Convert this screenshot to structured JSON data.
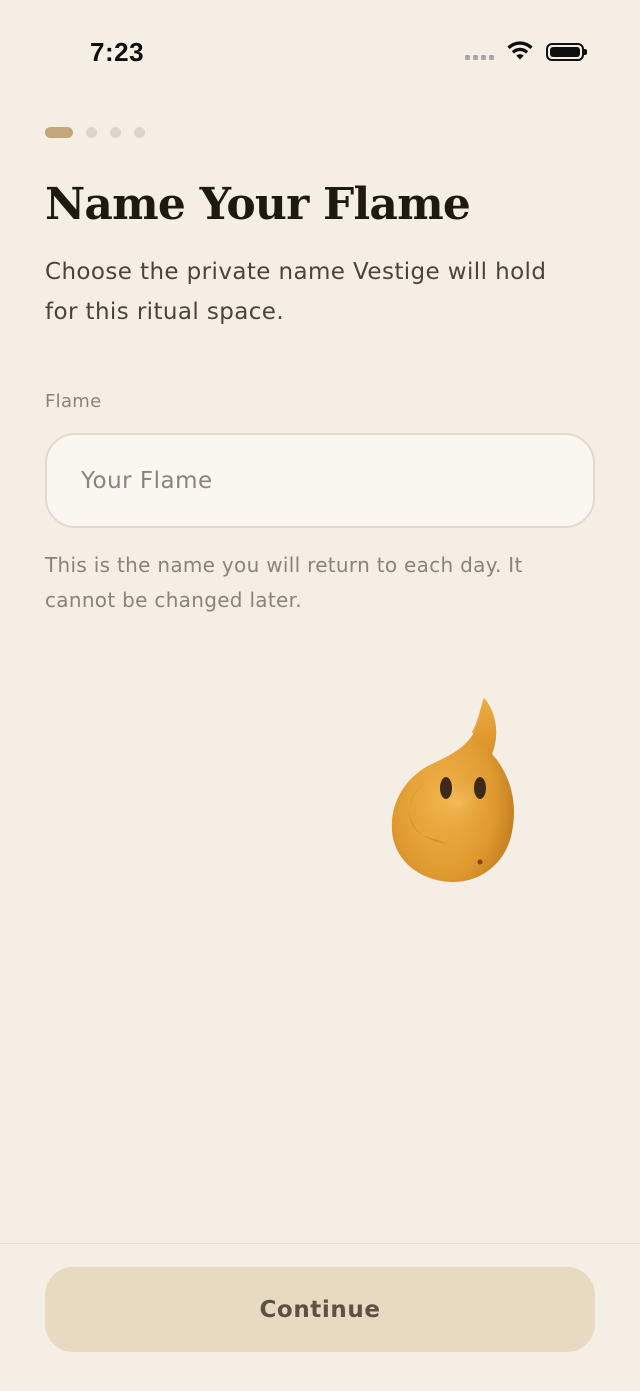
{
  "status_bar": {
    "time": "7:23",
    "icons": [
      "cellular-signal-icon",
      "wifi-icon",
      "battery-icon"
    ]
  },
  "steps": {
    "total": 4,
    "current": 1
  },
  "header": {
    "title": "Name Your Flame",
    "subtitle": "Choose the private name Vestige will hold for this ritual space."
  },
  "form": {
    "label": "Flame",
    "value": "",
    "placeholder": "Your Flame",
    "helper": "This is the name you will return to each day. It cannot be changed later."
  },
  "mascot": {
    "icon": "flame-mascot-icon"
  },
  "footer": {
    "continue_label": "Continue"
  },
  "colors": {
    "background": "#F4EEE5",
    "accent": "#C5A67A",
    "button": "#E8DAC1",
    "title": "#1E1A12"
  }
}
